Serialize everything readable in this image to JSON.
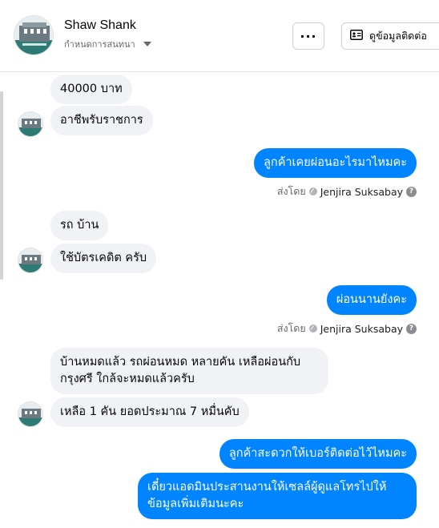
{
  "header": {
    "name": "Shaw Shank",
    "subtitle": "กำหนดการสนทนา",
    "more_label": "···",
    "contact_label": "ดูข้อมูลติดต่อ"
  },
  "messages": [
    {
      "text": "40000 บาท",
      "direction": "in"
    },
    {
      "text": "อาชีพรับราชการ",
      "direction": "in"
    },
    {
      "text": "ลูกค้าเคยผ่อนอะไรมาไหมคะ",
      "direction": "out"
    },
    {
      "text": "รถ บ้าน",
      "direction": "in"
    },
    {
      "text": "ใช้บัตรเคดิต ครับ",
      "direction": "in"
    },
    {
      "text": "ผ่อนนานยังคะ",
      "direction": "out"
    },
    {
      "text": "บ้านหมดแล้ว รถผ่อนหมด หลายคัน เหลือผ่อนกับกรุงศรี ใกล้จะหมดแล้วครับ",
      "direction": "in"
    },
    {
      "text": "เหลือ 1 คัน ยอดประมาณ 7 หมื่นคับ",
      "direction": "in"
    },
    {
      "text": "ลูกค้าสะดวกให้เบอร์ติดต่อไว้ไหมคะ",
      "direction": "out"
    },
    {
      "text": "เดี๋ยวแอดมินประสานงานให้เซลล์ผู้ดูแลโทรไปให้ข้อมูลเพิ่มเติมนะคะ",
      "direction": "out"
    }
  ],
  "sent_by": [
    {
      "prefix": "ส่งโดย",
      "sender": "Jenjira Suksabay"
    },
    {
      "prefix": "ส่งโดย",
      "sender": "Jenjira Suksabay"
    }
  ],
  "colors": {
    "outgoing_bubble": "#0084ff",
    "incoming_bubble": "#f0f2f5"
  },
  "icons": {
    "more": "more-horizontal-icon",
    "contact": "contact-card-icon",
    "help": "help-circle-icon"
  }
}
